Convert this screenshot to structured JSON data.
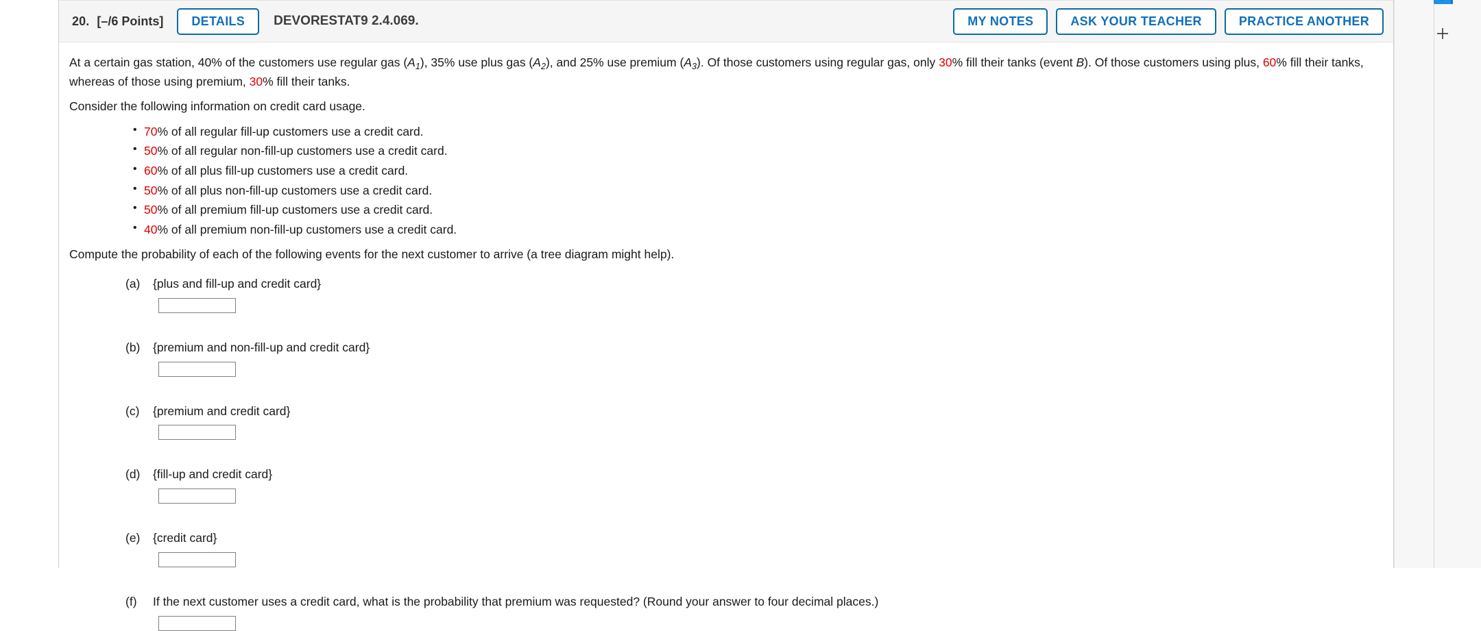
{
  "header": {
    "question_number": "20.",
    "points": "[–/6 Points]",
    "details_label": "DETAILS",
    "title": "DEVORESTAT9 2.4.069.",
    "actions": [
      {
        "label": "MY NOTES",
        "name": "my-notes-button"
      },
      {
        "label": "ASK YOUR TEACHER",
        "name": "ask-your-teacher-button"
      },
      {
        "label": "PRACTICE ANOTHER",
        "name": "practice-another-button"
      }
    ],
    "accent_color": "#0a6ba1",
    "link_color": "#1170b8",
    "background": "#f5f5f5"
  },
  "problem": {
    "intro_p1_a": "At a certain gas station, 40% of the customers use regular gas (",
    "intro_A1": "A",
    "intro_A1_sub": "1",
    "intro_p1_b": "), 35% use plus gas (",
    "intro_A2": "A",
    "intro_A2_sub": "2",
    "intro_p1_c": "), and 25% use premium (",
    "intro_A3": "A",
    "intro_A3_sub": "3",
    "intro_p1_d": "). Of those customers using regular gas, only ",
    "pct_regular_fill": "30",
    "intro_p1_e": "% fill their tanks (event ",
    "event_B": "B",
    "intro_p1_f": "). Of those customers using plus, ",
    "pct_plus_fill": "60",
    "intro_p1_g": "% fill their tanks, whereas of those using premium, ",
    "pct_premium_fill": "30",
    "intro_p1_h": "% fill their tanks.",
    "consider_line": "Consider the following information on credit card usage.",
    "credit_card_items": [
      {
        "pct": "70",
        "text": "% of all regular fill-up customers use a credit card."
      },
      {
        "pct": "50",
        "text": "% of all regular non-fill-up customers use a credit card."
      },
      {
        "pct": "60",
        "text": "% of all plus fill-up customers use a credit card."
      },
      {
        "pct": "50",
        "text": "% of all plus non-fill-up customers use a credit card."
      },
      {
        "pct": "50",
        "text": "% of all premium fill-up customers use a credit card."
      },
      {
        "pct": "40",
        "text": "% of all premium non-fill-up customers use a credit card."
      }
    ],
    "compute_line": "Compute the probability of each of the following events for the next customer to arrive (a tree diagram might help)."
  },
  "parts": [
    {
      "label": "(a)",
      "text": "{plus and fill-up and credit card}",
      "value": "",
      "name": "part-a"
    },
    {
      "label": "(b)",
      "text": "{premium and non-fill-up and credit card}",
      "value": "",
      "name": "part-b"
    },
    {
      "label": "(c)",
      "text": "{premium and credit card}",
      "value": "",
      "name": "part-c"
    },
    {
      "label": "(d)",
      "text": "{fill-up and credit card}",
      "value": "",
      "name": "part-d"
    },
    {
      "label": "(e)",
      "text": "{credit card}",
      "value": "",
      "name": "part-e"
    },
    {
      "label": "(f)",
      "text": "If the next customer uses a credit card, what is the probability that premium was requested? (Round your answer to four decimal places.)",
      "value": "",
      "name": "part-f"
    }
  ],
  "right_rail": {
    "app_icon": "mail-app-icon",
    "add_icon": "plus-icon",
    "background": "#f7f7f7"
  },
  "colors": {
    "red_highlight": "#e00000",
    "text": "#1a1a1a",
    "border": "#cfcfcf"
  }
}
